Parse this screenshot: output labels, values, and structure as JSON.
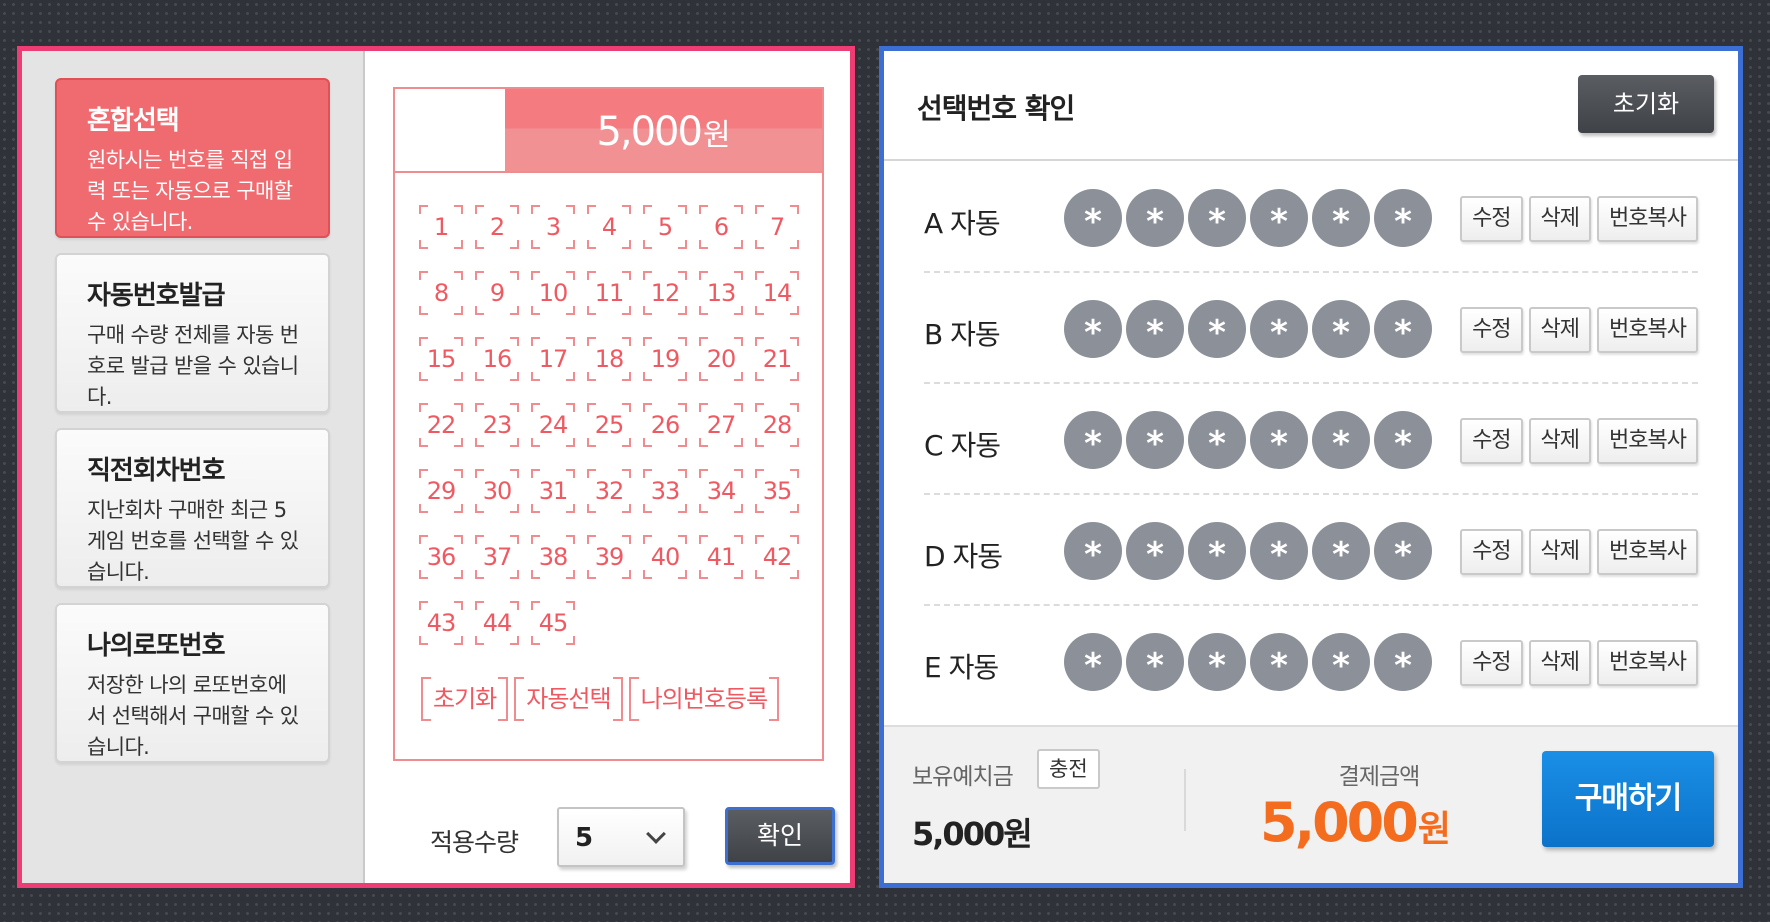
{
  "modes": [
    {
      "title": "혼합선택",
      "desc": "원하시는 번호를 직접 입력 또는 자동으로 구매할 수 있습니다.",
      "active": true
    },
    {
      "title": "자동번호발급",
      "desc": "구매 수량 전체를 자동 번호로 발급 받을 수 있습니다.",
      "active": false
    },
    {
      "title": "직전회차번호",
      "desc": "지난회차 구매한 최근 5게임 번호를 선택할 수 있습니다.",
      "active": false
    },
    {
      "title": "나의로또번호",
      "desc": "저장한 나의 로또번호에서 선택해서 구매할 수 있습니다.",
      "active": false
    }
  ],
  "slip": {
    "price": "5,000",
    "price_unit": "원",
    "numbers": [
      "1",
      "2",
      "3",
      "4",
      "5",
      "6",
      "7",
      "8",
      "9",
      "10",
      "11",
      "12",
      "13",
      "14",
      "15",
      "16",
      "17",
      "18",
      "19",
      "20",
      "21",
      "22",
      "23",
      "24",
      "25",
      "26",
      "27",
      "28",
      "29",
      "30",
      "31",
      "32",
      "33",
      "34",
      "35",
      "36",
      "37",
      "38",
      "39",
      "40",
      "41",
      "42",
      "43",
      "44",
      "45"
    ],
    "actions": [
      "초기화",
      "자동선택",
      "나의번호등록"
    ]
  },
  "quantity": {
    "label": "적용수량",
    "value": "5"
  },
  "confirm_label": "확인",
  "right": {
    "title": "선택번호 확인",
    "reset_label": "초기화",
    "rows": [
      {
        "label": "A 자동",
        "balls": [
          "*",
          "*",
          "*",
          "*",
          "*",
          "*"
        ]
      },
      {
        "label": "B 자동",
        "balls": [
          "*",
          "*",
          "*",
          "*",
          "*",
          "*"
        ]
      },
      {
        "label": "C 자동",
        "balls": [
          "*",
          "*",
          "*",
          "*",
          "*",
          "*"
        ]
      },
      {
        "label": "D 자동",
        "balls": [
          "*",
          "*",
          "*",
          "*",
          "*",
          "*"
        ]
      },
      {
        "label": "E 자동",
        "balls": [
          "*",
          "*",
          "*",
          "*",
          "*",
          "*"
        ]
      }
    ],
    "row_buttons": [
      "수정",
      "삭제",
      "번호복사"
    ]
  },
  "footer": {
    "balance_label": "보유예치금",
    "charge_label": "충전",
    "balance_value": "5,000원",
    "pay_label": "결제금액",
    "pay_value": "5,000",
    "pay_unit": "원",
    "buy_label": "구매하기"
  },
  "colors": {
    "left_border": "#ee3d74",
    "right_border": "#3c6ed4",
    "active_mode": "#f06b70",
    "slip_red": "#ef5a62",
    "pay_orange": "#f46d1f",
    "buy_blue": "#1a8fe6",
    "ball_gray": "#8c9199"
  }
}
